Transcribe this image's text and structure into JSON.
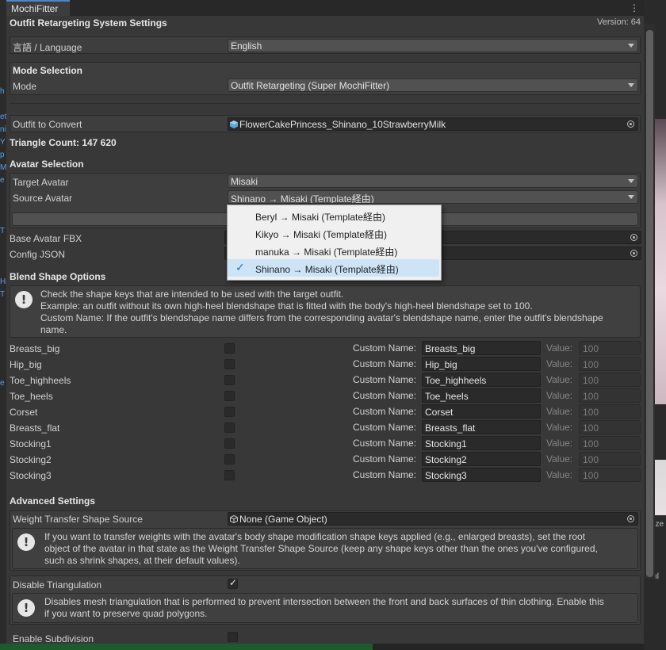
{
  "window": {
    "tab_title": "MochiFitter",
    "menu_icon": "kebab-menu-icon",
    "header_title": "Outfit Retargeting System Settings",
    "version": "Version: 64"
  },
  "language": {
    "label": "言語 / Language",
    "value": "English"
  },
  "mode_section": {
    "title": "Mode Selection",
    "mode_label": "Mode",
    "mode_value": "Outfit Retargeting (Super MochiFitter)"
  },
  "outfit": {
    "label": "Outfit to Convert",
    "value": "FlowerCakePrincess_Shinano_10StrawberryMilk",
    "triangle_count": "Triangle Count: 147 620"
  },
  "avatar_section": {
    "title": "Avatar Selection",
    "target_label": "Target Avatar",
    "target_value": "Misaki",
    "source_label": "Source Avatar",
    "source_value": "Shinano → Misaki (Template経由)",
    "base_fbx_label": "Base Avatar FBX",
    "config_json_label": "Config JSON"
  },
  "source_popup": {
    "items": [
      {
        "label": "Beryl → Misaki (Template経由)",
        "selected": false
      },
      {
        "label": "Kikyo → Misaki (Template経由)",
        "selected": false
      },
      {
        "label": "manuka → Misaki (Template経由)",
        "selected": false
      },
      {
        "label": "Shinano → Misaki (Template経由)",
        "selected": true
      }
    ]
  },
  "blend_section": {
    "title": "Blend Shape Options",
    "info_line1": "Check the shape keys that are intended to be used with the target outfit.",
    "info_line2": "Example: an outfit without its own high-heel blendshape that is fitted with the body's high-heel blendshape set to 100.",
    "info_line3": "Custom Name: If the outfit's blendshape name differs from the corresponding avatar's blendshape name, enter the outfit's blendshape",
    "info_line4": "name.",
    "custom_name_label": "Custom Name:",
    "value_label": "Value:",
    "rows": [
      {
        "name": "Breasts_big",
        "custom": "Breasts_big",
        "value": "100",
        "checked": false
      },
      {
        "name": "Hip_big",
        "custom": "Hip_big",
        "value": "100",
        "checked": false
      },
      {
        "name": "Toe_highheels",
        "custom": "Toe_highheels",
        "value": "100",
        "checked": false
      },
      {
        "name": "Toe_heels",
        "custom": "Toe_heels",
        "value": "100",
        "checked": false
      },
      {
        "name": "Corset",
        "custom": "Corset",
        "value": "100",
        "checked": false
      },
      {
        "name": "Breasts_flat",
        "custom": "Breasts_flat",
        "value": "100",
        "checked": false
      },
      {
        "name": "Stocking1",
        "custom": "Stocking1",
        "value": "100",
        "checked": false
      },
      {
        "name": "Stocking2",
        "custom": "Stocking2",
        "value": "100",
        "checked": false
      },
      {
        "name": "Stocking3",
        "custom": "Stocking3",
        "value": "100",
        "checked": false
      }
    ]
  },
  "advanced": {
    "title": "Advanced Settings",
    "weight_label": "Weight Transfer Shape Source",
    "weight_value": "None (Game Object)",
    "weight_info_1": "If you want to transfer weights with the avatar's body shape modification shape keys applied (e.g., enlarged breasts), set the root",
    "weight_info_2": "object of the avatar in that state as the Weight Transfer Shape Source (keep any shape keys other than the ones you've configured,",
    "weight_info_3": "such as shrink shapes, at their default values).",
    "tri_label": "Disable Triangulation",
    "tri_checked": true,
    "tri_info_1": "Disables mesh triangulation that is performed to prevent intersection between the front and back surfaces of thin clothing. Enable this",
    "tri_info_2": "if you want to preserve quad polygons.",
    "subdiv_label": "Enable Subdivision",
    "subdiv_checked": false
  },
  "background": {
    "left_fragments": [
      "h",
      "et",
      "ni",
      "Y",
      "p",
      "M",
      "e",
      "T",
      "Ha",
      "T",
      "e"
    ],
    "right_fragments": [
      "lize",
      "ıl"
    ]
  },
  "colors": {
    "panel": "#383838",
    "accent_tab": "#4d86c8",
    "popup_bg": "#f0f0f0",
    "popup_selected": "#cde4f7",
    "check_blue": "#2a71c4"
  }
}
